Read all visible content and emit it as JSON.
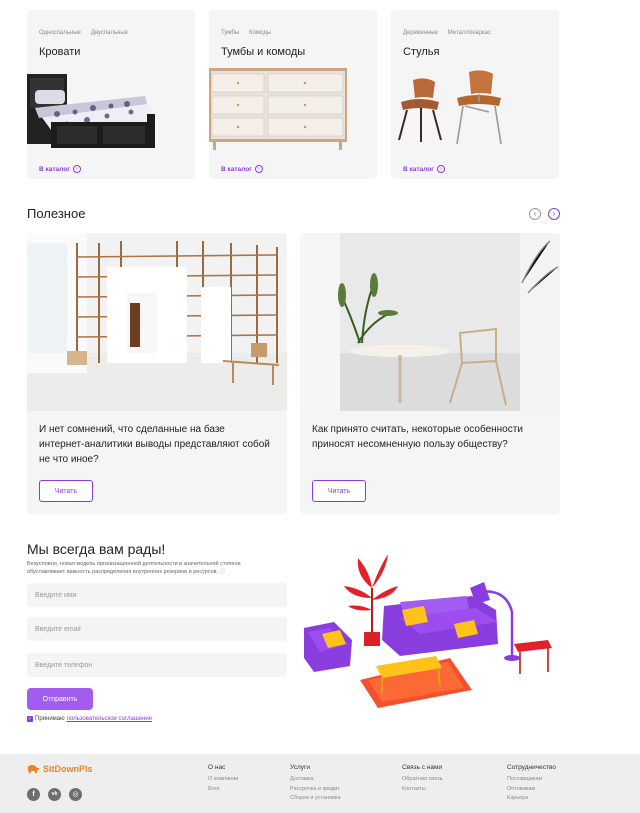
{
  "categories": [
    {
      "tags": [
        "Односпальные",
        "Двуспальные"
      ],
      "title": "Кровати",
      "link": "В каталог"
    },
    {
      "tags": [
        "Тумбы",
        "Комоды"
      ],
      "title": "Тумбы и комоды",
      "link": "В каталог"
    },
    {
      "tags": [
        "Деревянные",
        "Металлокаркас"
      ],
      "title": "Стулья",
      "link": "В каталог"
    }
  ],
  "useful": {
    "title": "Полезное",
    "prev_icon": "chevron-left-icon",
    "next_icon": "chevron-right-icon",
    "articles": [
      {
        "text": "И нет сомнений, что сделанные на базе интернет-аналитики выводы представляют собой не что иное?",
        "button": "Читать"
      },
      {
        "text": "Как принято считать, некоторые особенности приносят несомненную пользу обществу?",
        "button": "Читать"
      }
    ]
  },
  "contact_form": {
    "title": "Мы всегда вам рады!",
    "subtitle": "Безусловно, новая модель организационной деятельности в значительной степени обуславливает важность распределения внутренних резервов и ресурсов.",
    "name_placeholder": "Введите имя",
    "email_placeholder": "Введите email",
    "phone_placeholder": "Введите телефон",
    "submit": "Отправить",
    "consent_prefix": "Принимаю",
    "consent_link": "пользовательское соглашение"
  },
  "footer": {
    "logo": "SitDownPls",
    "columns": [
      {
        "title": "О нас",
        "links": [
          "О компании",
          "Блог"
        ]
      },
      {
        "title": "Услуги",
        "links": [
          "Доставка",
          "Рассрочка и кредит",
          "Сборка и установка"
        ]
      },
      {
        "title": "Связь с нами",
        "links": [
          "Обратная связь",
          "Контакты"
        ]
      },
      {
        "title": "Сотрудничество",
        "links": [
          "Поставщикам",
          "Оптовикам",
          "Карьера"
        ]
      }
    ],
    "socials": [
      "facebook-icon",
      "vk-icon",
      "instagram-icon"
    ]
  },
  "colors": {
    "accent": "#8a3ddf",
    "button": "#a35cf0",
    "logo": "#e8852c",
    "card_bg": "#f5f5f5",
    "footer_bg": "#eeeeee"
  }
}
